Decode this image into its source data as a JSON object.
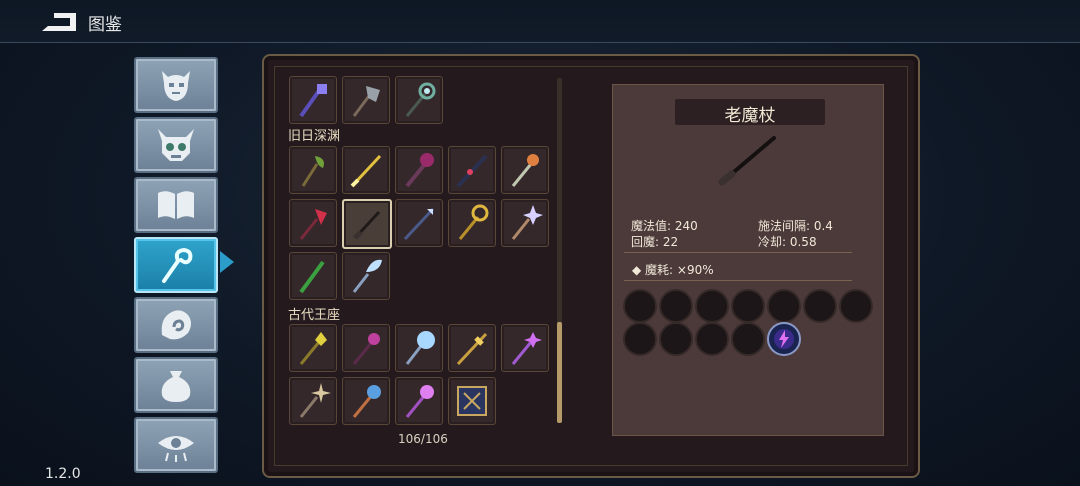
{
  "header": {
    "title": "图鉴"
  },
  "version": "1.2.0",
  "categories": [
    {
      "icon": "demon-face-icon"
    },
    {
      "icon": "horned-skull-icon"
    },
    {
      "icon": "open-book-icon"
    },
    {
      "icon": "magic-staff-icon",
      "active": true
    },
    {
      "icon": "swirl-hand-icon"
    },
    {
      "icon": "pouch-icon"
    },
    {
      "icon": "eye-icon"
    }
  ],
  "collection": {
    "sections": [
      "旧日深渊",
      "古代王座"
    ],
    "count": "106/106"
  },
  "detail": {
    "name": "老魔杖",
    "stats": {
      "mana_label": "魔法值: 240",
      "interval_label": "施法间隔: 0.4",
      "regen_label": "回魔: 22",
      "cooldown_label": "冷却: 0.58"
    },
    "cost": "◆ 魔耗: ×90%",
    "slots_total": 11,
    "slots_filled": 1
  },
  "colors": {
    "accent": "#2b9dc8",
    "gold": "#b59a6a",
    "panel": "#4c3a3a"
  }
}
